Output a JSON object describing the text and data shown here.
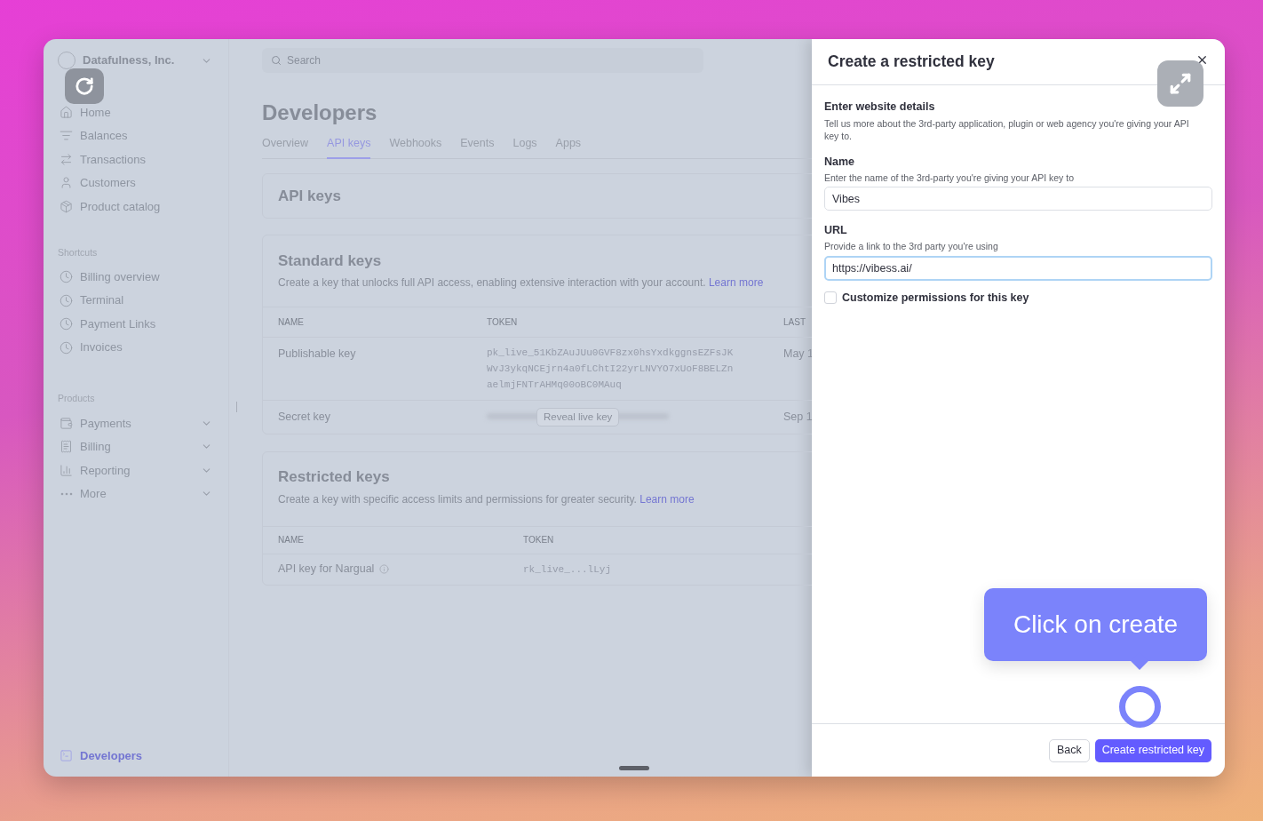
{
  "org": {
    "name": "Datafulness, Inc."
  },
  "sidebar": {
    "items": [
      {
        "label": "Home"
      },
      {
        "label": "Balances"
      },
      {
        "label": "Transactions"
      },
      {
        "label": "Customers"
      },
      {
        "label": "Product catalog"
      }
    ],
    "sections": [
      {
        "title": "Shortcuts",
        "items": [
          {
            "label": "Billing overview",
            "expandable": false
          },
          {
            "label": "Terminal",
            "expandable": false
          },
          {
            "label": "Payment Links",
            "expandable": false
          },
          {
            "label": "Invoices",
            "expandable": false
          }
        ]
      },
      {
        "title": "Products",
        "items": [
          {
            "label": "Payments",
            "expandable": true
          },
          {
            "label": "Billing",
            "expandable": true
          },
          {
            "label": "Reporting",
            "expandable": true
          },
          {
            "label": "More",
            "expandable": true
          }
        ]
      }
    ],
    "footer": {
      "label": "Developers",
      "selected": true
    }
  },
  "search": {
    "placeholder": "Search"
  },
  "page": {
    "title": "Developers",
    "tabs": [
      {
        "label": "Overview",
        "selected": false
      },
      {
        "label": "API keys",
        "selected": true
      },
      {
        "label": "Webhooks",
        "selected": false
      },
      {
        "label": "Events",
        "selected": false
      },
      {
        "label": "Logs",
        "selected": false
      },
      {
        "label": "Apps",
        "selected": false
      }
    ]
  },
  "api_keys_card": {
    "title": "API keys"
  },
  "standard_keys": {
    "title": "Standard keys",
    "description": "Create a key that unlocks full API access, enabling extensive interaction with your account.",
    "link": "Learn more",
    "columns": [
      "NAME",
      "TOKEN",
      "LAST"
    ],
    "rows": [
      {
        "name": "Publishable key",
        "token": [
          "pk_live_51KbZAuJUu0GVF8zx0hsYxdkggnsEZFsJK",
          "WvJ3ykqNCEjrn4a0fLChtI22yrLNVYO7xUoF8BELZn",
          "aelmjFNTrAHMq00oBC0MAuq"
        ],
        "last": "May 1"
      },
      {
        "name": "Secret key",
        "button": "Reveal live key",
        "last": "Sep 1"
      }
    ]
  },
  "restricted_keys": {
    "title": "Restricted keys",
    "description": "Create a key with specific access limits and permissions for greater security.",
    "link": "Learn more",
    "columns": [
      "NAME",
      "TOKEN"
    ],
    "rows": [
      {
        "name": "API key for Nargual",
        "token": "rk_live_...lLyj"
      }
    ]
  },
  "drawer": {
    "title": "Create a restricted key",
    "section_title": "Enter website details",
    "section_description": "Tell us more about the 3rd-party application, plugin or web agency you're giving your API key to.",
    "fields": [
      {
        "label": "Name",
        "hint": "Enter the name of the 3rd-party you're giving your API key to",
        "value": "Vibes",
        "focused": false
      },
      {
        "label": "URL",
        "hint": "Provide a link to the 3rd party you're using",
        "value": "https://vibess.ai/",
        "focused": true
      }
    ],
    "checkbox": {
      "label": "Customize permissions for this key",
      "checked": false
    },
    "buttons": [
      {
        "label": "Back",
        "kind": "secondary"
      },
      {
        "label": "Create restricted key",
        "kind": "primary"
      }
    ]
  },
  "tooltip": {
    "text": "Click on create"
  }
}
